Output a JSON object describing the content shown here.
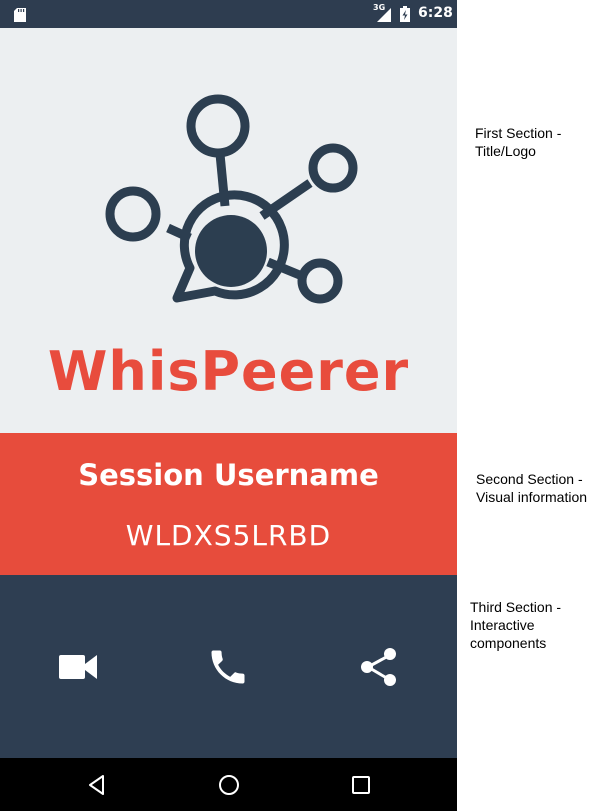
{
  "status_bar": {
    "network": "3G",
    "time": "6:28",
    "icons": [
      "sd-card-icon",
      "signal-icon",
      "battery-icon"
    ]
  },
  "logo_section": {
    "app_name": "WhisPeerer",
    "logo_icon": "network-bubble-logo-icon"
  },
  "info_section": {
    "title": "Session Username",
    "username": "WLDXS5LRBD"
  },
  "actions": [
    {
      "name": "video-call",
      "icon": "video-camera-icon"
    },
    {
      "name": "voice-call",
      "icon": "phone-icon"
    },
    {
      "name": "share",
      "icon": "share-icon"
    }
  ],
  "nav_bar": {
    "icons": [
      "back-icon",
      "home-icon",
      "recents-icon"
    ]
  },
  "annotations": {
    "first": "First Section - Title/Logo",
    "second": "Second Section - Visual information",
    "third": "Third Section - Interactive components"
  },
  "colors": {
    "dark_blue": "#2e3e52",
    "red": "#e74c3c",
    "light_gray": "#eceff1",
    "white": "#ffffff"
  }
}
